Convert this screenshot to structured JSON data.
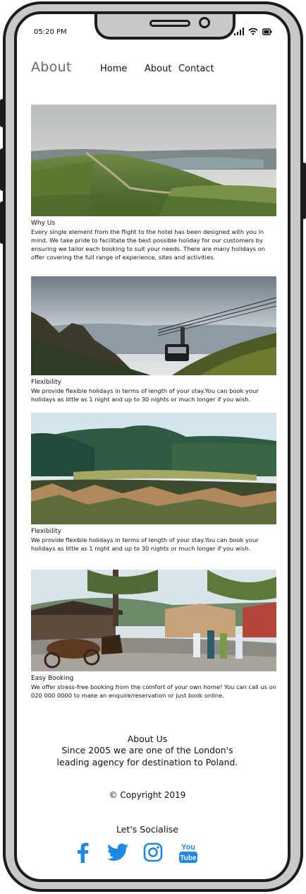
{
  "status_bar": {
    "time": "05:20 PM"
  },
  "nav": {
    "logo": "About",
    "links": [
      "Home",
      "About",
      "Contact"
    ]
  },
  "sections": [
    {
      "title": "Why Us",
      "text": "Every single element from the flight to the hotel has been designed with you in mind. We take pride to facilitate the best possible holiday for our customers by ensuring we tailor each booking to suit your needs. There are many holidays on offer covering the full range of experience, sites and activities."
    },
    {
      "title": "Flexibility",
      "text": "We provide flexible holidays in terms of length of your stay.You can book your holidays as little as 1 night and up to 30 nights or much longer if you wish."
    },
    {
      "title": "Flexibility",
      "text": "We provide flexible holidays in terms of length of your stay.You can book your holidays as little as 1 night and up to 30 nights or much longer if you wish."
    },
    {
      "title": "Easy Booking",
      "text": "We offer stress-free booking from the comfort of your own home! You can call us on 020 000 0000 to make an enquire/reservation or just book online."
    }
  ],
  "about": {
    "heading": "About Us",
    "line1": "Since 2005 we are one of the London's",
    "line2": "leading agency for destination to Poland."
  },
  "copyright": "© Copyright 2019",
  "social": {
    "heading": "Let's Socialise",
    "icons": [
      "facebook-icon",
      "twitter-icon",
      "instagram-icon",
      "youtube-icon"
    ],
    "icon_color": "#1e88e5"
  }
}
